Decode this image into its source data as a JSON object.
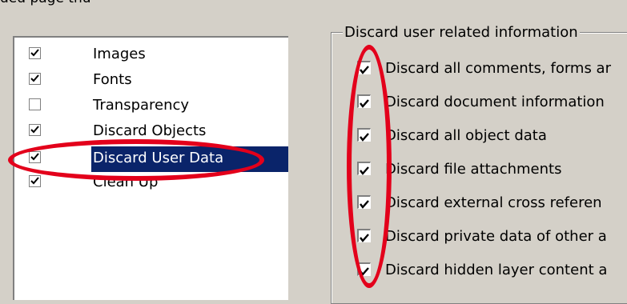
{
  "top_text": "ded page thu",
  "list": {
    "items": [
      {
        "label": "Images",
        "checked": true,
        "selected": false
      },
      {
        "label": "Fonts",
        "checked": true,
        "selected": false
      },
      {
        "label": "Transparency",
        "checked": false,
        "selected": false
      },
      {
        "label": "Discard Objects",
        "checked": true,
        "selected": false
      },
      {
        "label": "Discard User Data",
        "checked": true,
        "selected": true
      },
      {
        "label": "Clean Up",
        "checked": true,
        "selected": false
      }
    ]
  },
  "group": {
    "legend": "Discard user related information",
    "options": [
      {
        "label": "Discard all comments, forms ar",
        "checked": true
      },
      {
        "label": "Discard document information",
        "checked": true
      },
      {
        "label": "Discard all object data",
        "checked": true
      },
      {
        "label": "Discard file attachments",
        "checked": true
      },
      {
        "label": "Discard external cross referen",
        "checked": true
      },
      {
        "label": "Discard private data of other a",
        "checked": true
      },
      {
        "label": "Discard hidden layer content a",
        "checked": true
      }
    ]
  },
  "colors": {
    "highlight": "#0a246a",
    "annotation": "#e3001b",
    "background": "#d4d0c8"
  }
}
